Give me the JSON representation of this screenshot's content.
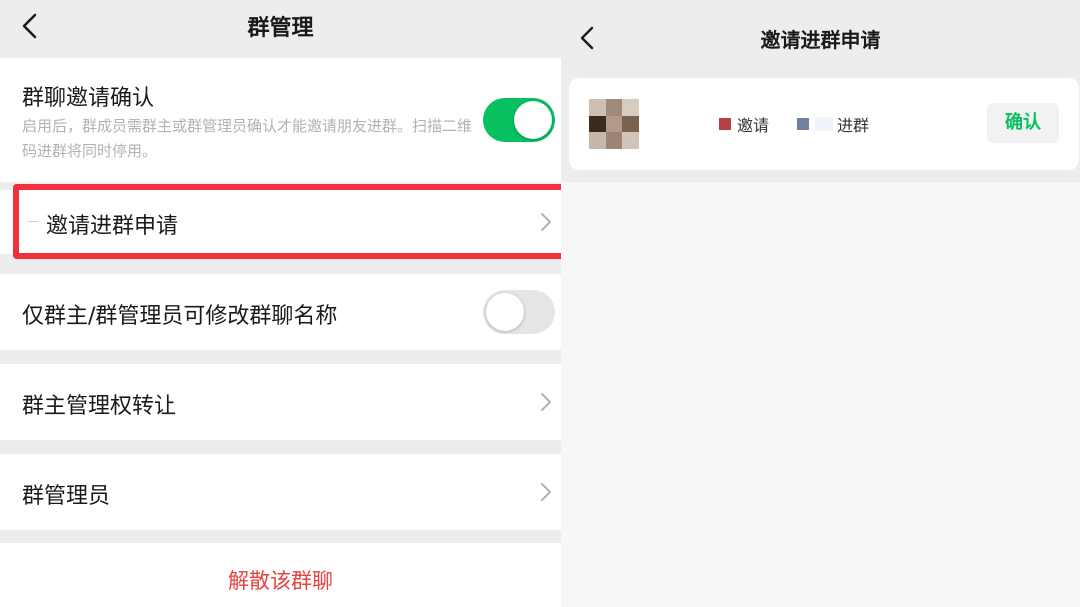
{
  "left": {
    "title": "群管理",
    "invite_confirm": {
      "label": "群聊邀请确认",
      "description": "启用后，群成员需群主或群管理员确认才能邀请朋友进群。扫描二维码进群将同时停用。",
      "enabled": true
    },
    "invite_requests": {
      "label": "邀请进群申请"
    },
    "rename_restrict": {
      "label": "仅群主/群管理员可修改群聊名称",
      "enabled": false
    },
    "transfer_owner": {
      "label": "群主管理权转让"
    },
    "admins": {
      "label": "群管理员"
    },
    "dismiss": {
      "label": "解散该群聊"
    }
  },
  "right": {
    "title": "邀请进群申请",
    "request": {
      "invite_text": "邀请",
      "join_text": "进群",
      "confirm_label": "确认"
    }
  },
  "colors": {
    "accent_green": "#07c160",
    "danger_red": "#e64340",
    "highlight_red": "#f0303c"
  },
  "icons": [
    "back-chevron-icon",
    "right-chevron-icon",
    "toggle-switch",
    "blurred-avatar"
  ]
}
